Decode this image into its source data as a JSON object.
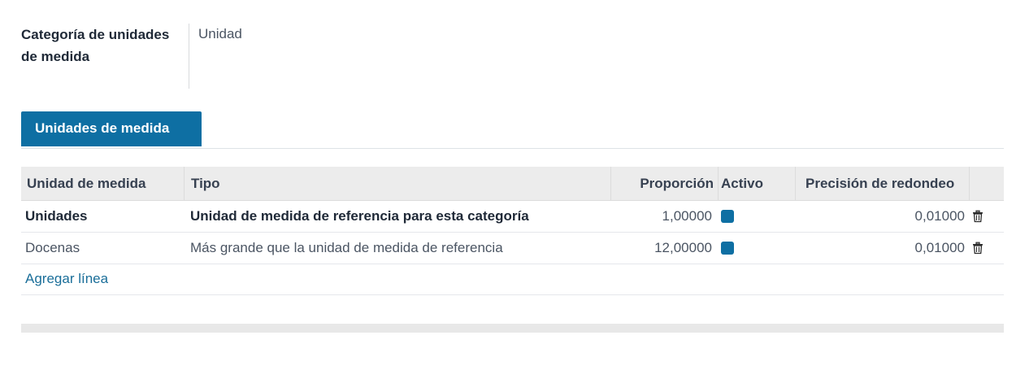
{
  "field": {
    "label": "Categoría de unidades de medida",
    "value": "Unidad"
  },
  "tabs": [
    {
      "label": "Unidades de medida",
      "active": true
    }
  ],
  "table": {
    "columns": [
      "Unidad de medida",
      "Tipo",
      "Proporción",
      "Activo",
      "Precisión de redondeo"
    ],
    "rows": [
      {
        "unit": "Unidades",
        "type": "Unidad de medida de referencia para esta categoría",
        "ratio": "1,00000",
        "active": true,
        "rounding": "0,01000",
        "bold": true
      },
      {
        "unit": "Docenas",
        "type": "Más grande que la unidad de medida de referencia",
        "ratio": "12,00000",
        "active": true,
        "rounding": "0,01000",
        "bold": false
      }
    ],
    "add_line_label": "Agregar línea"
  },
  "icons": {
    "delete": "trash-icon",
    "active": "checkbox-checked"
  },
  "colors": {
    "accent": "#0e6fa3",
    "link": "#1a6e99",
    "header_bg": "#ececec"
  }
}
